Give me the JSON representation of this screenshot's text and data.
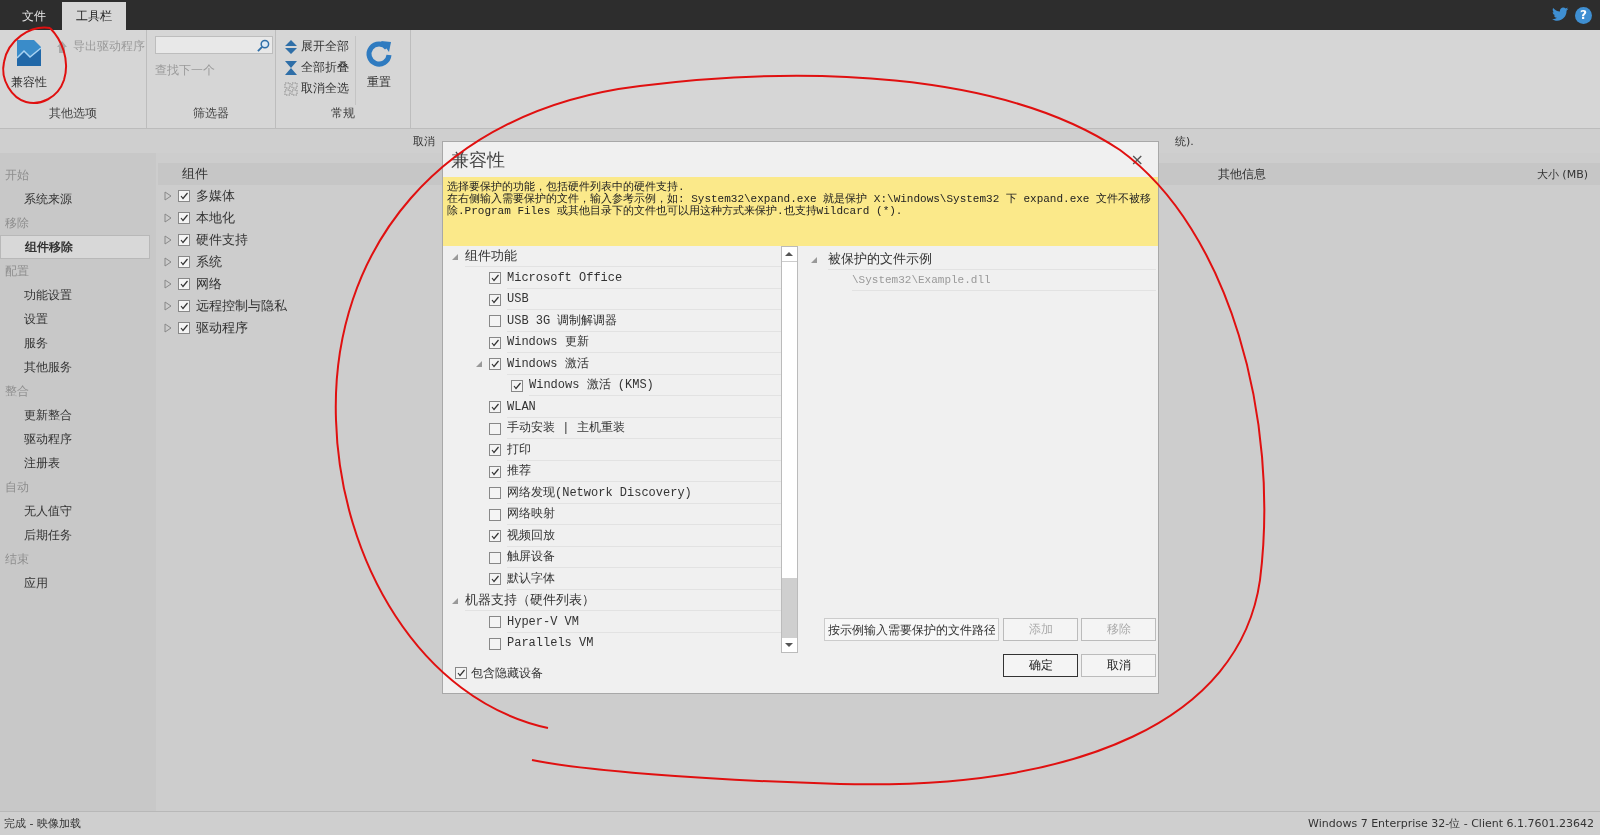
{
  "menu_tabs": [
    {
      "label": "文件",
      "selected": false
    },
    {
      "label": "工具栏",
      "selected": true
    }
  ],
  "help": "?",
  "ribbon": {
    "other": {
      "label": "其他选项",
      "compat": {
        "label": "兼容性",
        "disabled": false
      },
      "export": {
        "label": "导出驱动程序",
        "disabled": true
      }
    },
    "filter": {
      "label": "筛选器",
      "find_next": {
        "label": "查找下一个",
        "disabled": true
      }
    },
    "general": {
      "label": "常规",
      "expand_all": "展开全部",
      "collapse_all": "全部折叠",
      "deselect_all": "取消全选",
      "reset": "重置"
    }
  },
  "notice": [
    "取消",
    "统)."
  ],
  "sidebar": [
    {
      "title": "开始",
      "items": [
        {
          "label": "系统来源",
          "selected": false
        }
      ]
    },
    {
      "title": "移除",
      "items": [
        {
          "label": "组件移除",
          "selected": true
        }
      ]
    },
    {
      "title": "配置",
      "items": [
        {
          "label": "功能设置",
          "selected": false
        },
        {
          "label": "设置",
          "selected": false
        },
        {
          "label": "服务",
          "selected": false
        },
        {
          "label": "其他服务",
          "selected": false
        }
      ]
    },
    {
      "title": "整合",
      "items": [
        {
          "label": "更新整合",
          "selected": false
        },
        {
          "label": "驱动程序",
          "selected": false
        },
        {
          "label": "注册表",
          "selected": false
        }
      ]
    },
    {
      "title": "自动",
      "items": [
        {
          "label": "无人值守",
          "selected": false
        },
        {
          "label": "后期任务",
          "selected": false
        }
      ]
    },
    {
      "title": "结束",
      "items": [
        {
          "label": "应用",
          "selected": false
        }
      ]
    }
  ],
  "table": {
    "columns": [
      "组件",
      "其他信息",
      "大小 (MB)"
    ],
    "rows": [
      {
        "label": "多媒体",
        "checked": true,
        "expanded": false
      },
      {
        "label": "本地化",
        "checked": true,
        "expanded": false
      },
      {
        "label": "硬件支持",
        "checked": true,
        "expanded": false
      },
      {
        "label": "系统",
        "checked": true,
        "expanded": false
      },
      {
        "label": "网络",
        "checked": true,
        "expanded": false
      },
      {
        "label": "远程控制与隐私",
        "checked": true,
        "expanded": false
      },
      {
        "label": "驱动程序",
        "checked": true,
        "expanded": false
      }
    ]
  },
  "dialog": {
    "title": "兼容性",
    "close": "×",
    "banner": [
      "选择要保护的功能，包括硬件列表中的硬件支持.",
      "在右侧输入需要保护的文件，输入参考示例，如: System32\\expand.exe 就是保护 X:\\Windows\\System32 下 expand.exe 文件不被移除.Program Files 或其他目录下的文件也可以用这种方式来保护.也支持Wildcard (*)."
    ],
    "tree": [
      {
        "label": "组件功能",
        "expanded": true,
        "children": [
          {
            "label": "Microsoft Office",
            "checked": true
          },
          {
            "label": "USB",
            "checked": true
          },
          {
            "label": "USB 3G 调制解调器",
            "checked": false
          },
          {
            "label": "Windows 更新",
            "checked": true
          },
          {
            "label": "Windows 激活",
            "checked": true,
            "expanded": true,
            "children": [
              {
                "label": "Windows 激活 (KMS)",
                "checked": true
              }
            ]
          },
          {
            "label": "WLAN",
            "checked": true
          },
          {
            "label": "手动安装 | 主机重装",
            "checked": false
          },
          {
            "label": "打印",
            "checked": true
          },
          {
            "label": "推荐",
            "checked": true
          },
          {
            "label": "网络发现(Network Discovery)",
            "checked": false
          },
          {
            "label": "网络映射",
            "checked": false
          },
          {
            "label": "视频回放",
            "checked": true
          },
          {
            "label": "触屏设备",
            "checked": false
          },
          {
            "label": "默认字体",
            "checked": true
          }
        ]
      },
      {
        "label": "机器支持（硬件列表）",
        "expanded": true,
        "children": [
          {
            "label": "Hyper-V VM",
            "checked": false
          },
          {
            "label": "Parallels VM",
            "checked": false
          }
        ]
      }
    ],
    "include_hidden": {
      "label": "包含隐藏设备",
      "checked": true
    },
    "protected": {
      "label": "被保护的文件示例",
      "expanded": true,
      "items": [
        "\\System32\\Example.dll"
      ]
    },
    "path_field": {
      "placeholder": "按示例输入需要保护的文件路径"
    },
    "add": {
      "label": "添加",
      "disabled": true
    },
    "remove": {
      "label": "移除",
      "disabled": true
    },
    "ok": {
      "label": "确定",
      "disabled": false
    },
    "cancel": {
      "label": "取消",
      "disabled": false
    }
  },
  "status": {
    "left": "完成 - 映像加载",
    "right": "Windows 7 Enterprise 32-位 - Client 6.1.7601.23642"
  }
}
